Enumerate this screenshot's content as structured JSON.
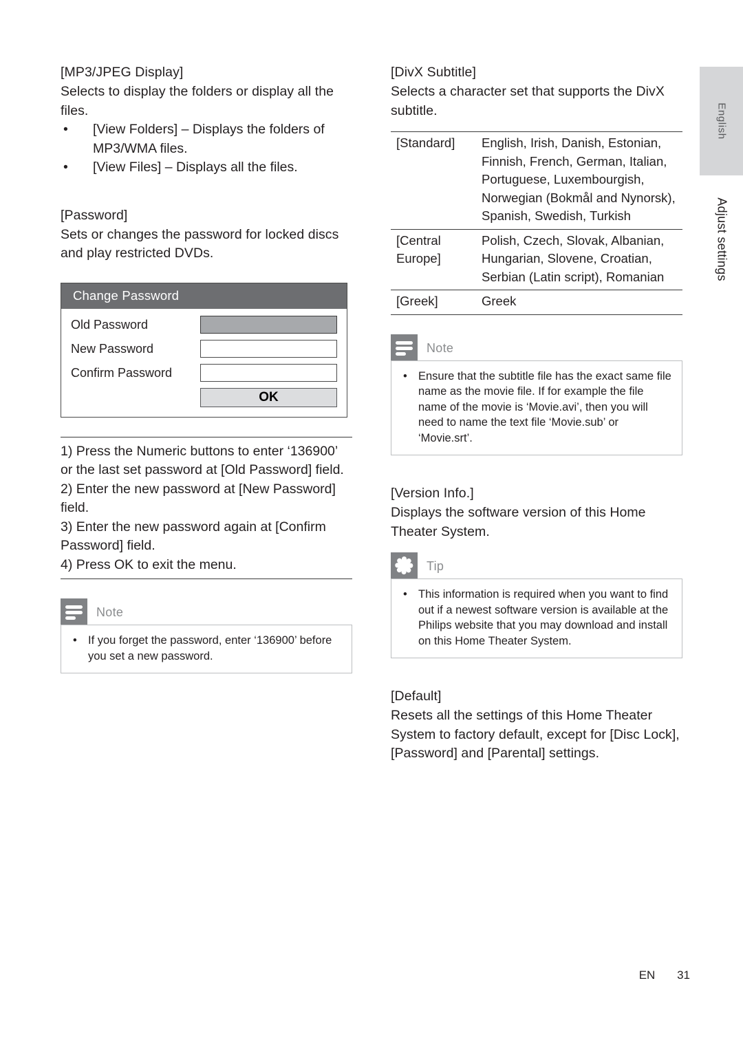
{
  "left_column": {
    "mp3_jpeg": {
      "heading": "[MP3/JPEG Display]",
      "body": "Selects to display the folders or display all the files.",
      "bullets": [
        "[View Folders] – Displays the folders of MP3/WMA files.",
        "[View Files] – Displays all the files."
      ],
      "bullet_char": "•"
    },
    "password": {
      "heading": "[Password]",
      "body": "Sets or changes the password for locked discs and play restricted DVDs."
    },
    "dialog": {
      "title": "Change Password",
      "fields": [
        {
          "label": "Old Password",
          "value": "",
          "filled": true
        },
        {
          "label": "New Password",
          "value": "",
          "filled": false
        },
        {
          "label": "Confirm Password",
          "value": "",
          "filled": false
        }
      ],
      "ok_label": "OK"
    },
    "steps": [
      "1) Press the Numeric buttons to enter ‘136900’ or the last set password at [Old Password] field.",
      "2) Enter the new password at [New Password] field.",
      "3) Enter the new password again at [Confirm Password] field.",
      "4) Press OK to exit the menu."
    ],
    "note": {
      "label": "Note",
      "icon": "note-lines-icon",
      "bullet_char": "•",
      "items": [
        "If you forget the password, enter ‘136900’ before you set a new password."
      ]
    }
  },
  "right_column": {
    "divx_subtitle": {
      "heading": "[DivX Subtitle]",
      "body": "Selects a character set that supports the DivX subtitle."
    },
    "charset_table": {
      "rows": [
        {
          "key": "[Standard]",
          "value": "English, Irish, Danish, Estonian, Finnish, French, German, Italian, Portuguese, Luxembourgish, Norwegian (Bokmål and Nynorsk), Spanish, Swedish, Turkish"
        },
        {
          "key": "[Central Europe]",
          "value": "Polish, Czech, Slovak, Albanian, Hungarian, Slovene, Croatian, Serbian (Latin script), Romanian"
        },
        {
          "key": "[Greek]",
          "value": "Greek"
        }
      ]
    },
    "note": {
      "label": "Note",
      "icon": "note-lines-icon",
      "bullet_char": "•",
      "items": [
        "Ensure that the subtitle file has the exact same file name as the movie file. If for example the file name of the movie is ‘Movie.avi’, then you will need to name the text file ‘Movie.sub’ or ‘Movie.srt’."
      ]
    },
    "version_info": {
      "heading": "[Version Info.]",
      "body": "Displays the software version of this Home Theater System."
    },
    "tip": {
      "label": "Tip",
      "icon": "asterisk-star-icon",
      "bullet_char": "•",
      "items": [
        "This information is required when you want to find out if a newest software version is available at the Philips website that you may download and install on this Home Theater System."
      ]
    },
    "default_section": {
      "heading": "[Default]",
      "body": "Resets all the settings of this Home Theater System to factory default, except for [Disc Lock], [Password] and [Parental] settings."
    }
  },
  "side_tabs": {
    "language": "English",
    "section": "Adjust settings"
  },
  "footer": {
    "language_code": "EN",
    "page_number": "31"
  },
  "colors": {
    "dialog_header": "#6d6e71",
    "callout_icon": "#808285",
    "filled_field": "#a7a9ac",
    "ok_button": "#dcdddf",
    "lang_tab": "#d5d6d8"
  }
}
